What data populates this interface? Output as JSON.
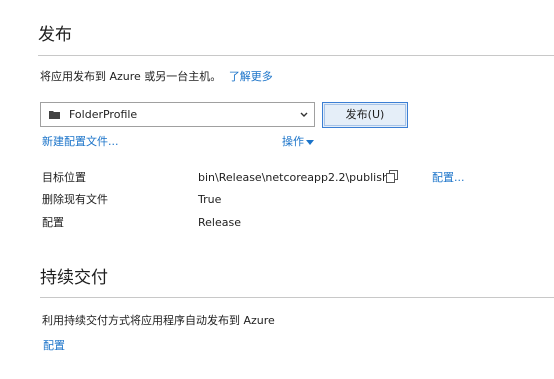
{
  "publish": {
    "heading": "发布",
    "description": "将应用发布到 Azure 或另一台主机。",
    "learn_more": "了解更多",
    "profile": {
      "icon": "folder-icon",
      "selected": "FolderProfile"
    },
    "publish_button": "发布(U)",
    "new_profile_link": "新建配置文件...",
    "actions_link": "操作",
    "details": {
      "target_label": "目标位置",
      "target_value": "bin\\Release\\netcoreapp2.2\\publish\\",
      "configure_link": "配置...",
      "delete_label": "删除现有文件",
      "delete_value": "True",
      "config_label": "配置",
      "config_value": "Release"
    }
  },
  "continuous_delivery": {
    "heading": "持续交付",
    "description": "利用持续交付方式将应用程序自动发布到 Azure",
    "configure_link": "配置"
  },
  "colors": {
    "link": "#1a73c9",
    "button_border": "#3c7fd4",
    "button_bg": "#e5eef8",
    "rule": "#c8c8c8"
  }
}
